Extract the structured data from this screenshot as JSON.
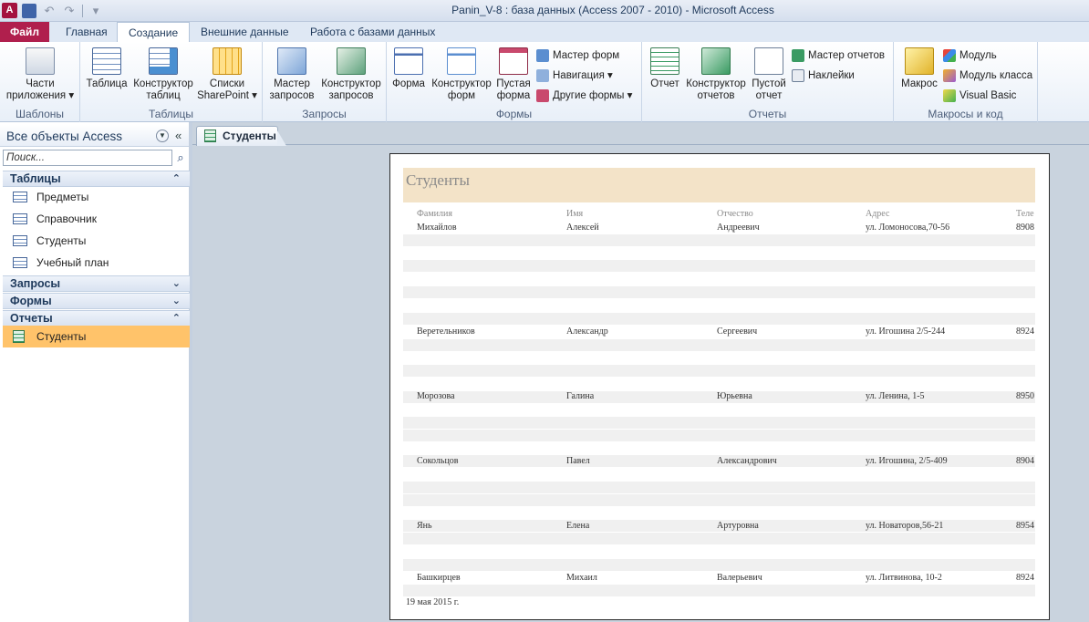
{
  "window": {
    "title": "Panin_V-8 : база данных (Access 2007 - 2010)  -  Microsoft Access",
    "app_icon": "A"
  },
  "tabs": [
    "Файл",
    "Главная",
    "Создание",
    "Внешние данные",
    "Работа с базами данных"
  ],
  "ribbon": {
    "groups": {
      "templates": "Шаблоны",
      "tables": "Таблицы",
      "queries": "Запросы",
      "forms": "Формы",
      "reports": "Отчеты",
      "macros": "Макросы и код"
    },
    "buttons": {
      "parts": "Части\nприложения ▾",
      "table": "Таблица",
      "table_design": "Конструктор\nтаблиц",
      "sharepoint": "Списки\nSharePoint ▾",
      "query_wizard": "Мастер\nзапросов",
      "query_design": "Конструктор\nзапросов",
      "form": "Форма",
      "form_design": "Конструктор\nформ",
      "blank_form": "Пустая\nформа",
      "form_wizard": "Мастер форм",
      "navigation": "Навигация ▾",
      "other_forms": "Другие формы ▾",
      "report": "Отчет",
      "report_design": "Конструктор\nотчетов",
      "blank_report": "Пустой\nотчет",
      "report_wizard": "Мастер отчетов",
      "labels": "Наклейки",
      "macro": "Макрос",
      "module": "Модуль",
      "class_module": "Модуль класса",
      "visual_basic": "Visual Basic"
    }
  },
  "nav": {
    "title": "Все объекты Access",
    "search_placeholder": "Поиск...",
    "categories": {
      "tables": "Таблицы",
      "queries": "Запросы",
      "forms": "Формы",
      "reports": "Отчеты"
    },
    "tables": [
      "Предметы",
      "Справочник",
      "Студенты",
      "Учебный план"
    ],
    "reports": [
      "Студенты"
    ]
  },
  "document": {
    "tab_label": "Студенты",
    "report_title": "Студенты",
    "columns": [
      "Фамилия",
      "Имя",
      "Отчество",
      "Адрес",
      "Теле"
    ],
    "rows": [
      [
        "Михайлов",
        "Алексей",
        "Андреевич",
        "ул. Ломоносова,70-56",
        "8908"
      ],
      [
        "Веретельников",
        "Александр",
        "Сергеевич",
        "ул. Игошина 2/5-244",
        "8924"
      ],
      [
        "Морозова",
        "Галина",
        "Юрьевна",
        "ул. Ленина, 1-5",
        "8950"
      ],
      [
        "Сокольцов",
        "Павел",
        "Александрович",
        "ул. Игошина, 2/5-409",
        "8904"
      ],
      [
        "Янь",
        "Елена",
        "Артуровна",
        "ул. Новаторов,56-21",
        "8954"
      ],
      [
        "Башкирцев",
        "Михаил",
        "Валерьевич",
        "ул. Литвинова, 10-2",
        "8924"
      ]
    ],
    "footer_date": "19 мая 2015 г."
  },
  "colors": {
    "file_tab": "#b01f4d",
    "selected_item": "#ffc36a",
    "report_header": "#f3e3c8"
  }
}
